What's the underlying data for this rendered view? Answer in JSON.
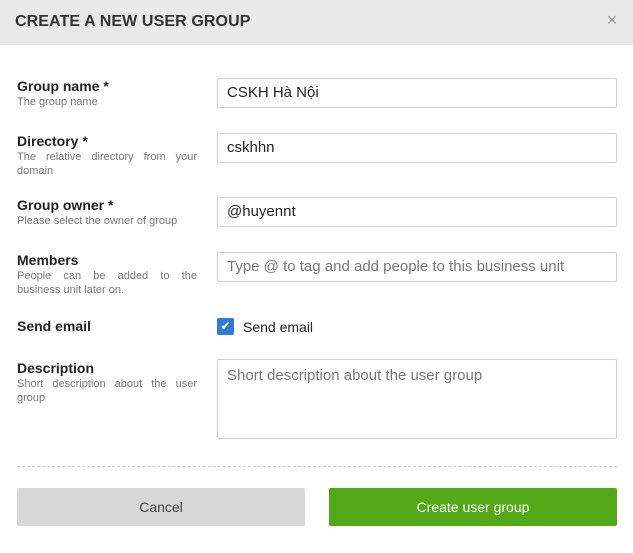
{
  "dialog": {
    "title": "CREATE A NEW USER GROUP",
    "close_icon": "×"
  },
  "fields": {
    "group_name": {
      "label": "Group name *",
      "hint": "The group name",
      "value": "CSKH Hà Nội"
    },
    "directory": {
      "label": "Directory *",
      "hint": "The relative directory from your domain",
      "value": "cskhhn"
    },
    "group_owner": {
      "label": "Group owner *",
      "hint": "Please select the owner of group",
      "value": "@huyennt"
    },
    "members": {
      "label": "Members",
      "hint": "People can be added to the business unit later on.",
      "placeholder": "Type @ to tag and add people to this business unit"
    },
    "send_email": {
      "label": "Send email",
      "checkbox_label": "Send email",
      "checked": true,
      "check_glyph": "✔"
    },
    "description": {
      "label": "Description",
      "hint": "Short description about the user group",
      "placeholder": "Short description about the user group"
    }
  },
  "buttons": {
    "cancel": "Cancel",
    "create": "Create user group"
  },
  "colors": {
    "header_bg": "#e9e9e9",
    "checkbox": "#2f7bd6",
    "create_button": "#52a918",
    "cancel_button": "#d7d7d7"
  }
}
